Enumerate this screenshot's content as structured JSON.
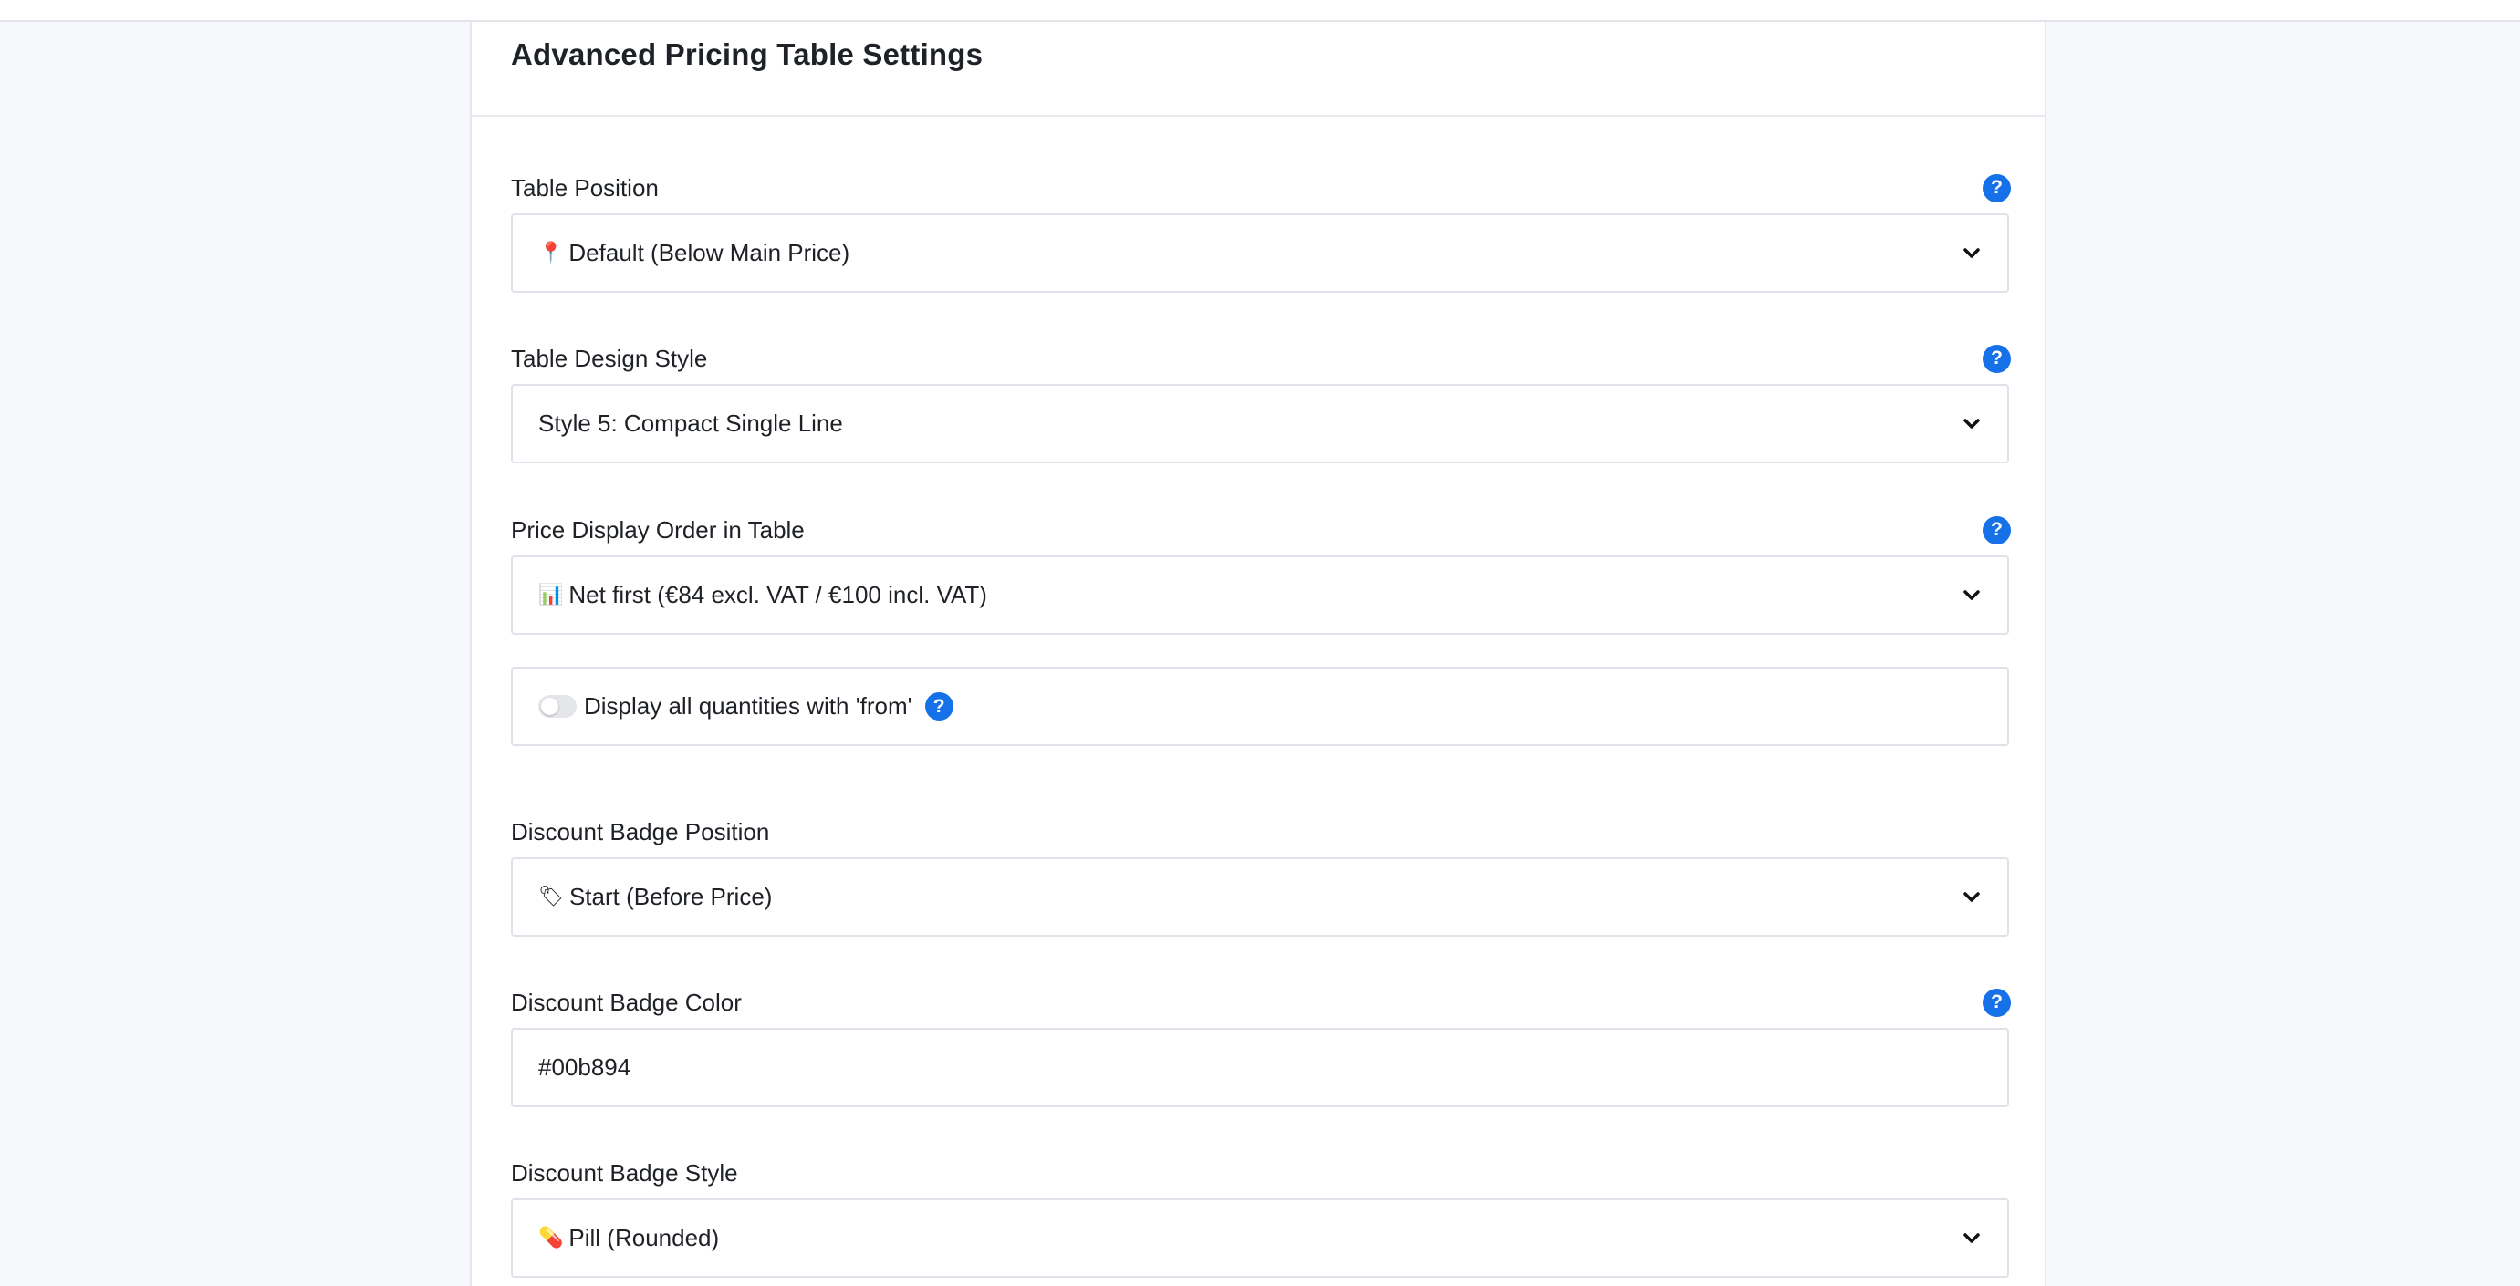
{
  "panel": {
    "title": "Advanced Pricing Table Settings"
  },
  "help_icon_glyph": "?",
  "fields": {
    "table_position": {
      "label": "Table Position",
      "emoji": "📍",
      "value": "Default (Below Main Price)",
      "icon": "pin-icon"
    },
    "table_design_style": {
      "label": "Table Design Style",
      "value": "Style 5: Compact Single Line"
    },
    "price_display_order": {
      "label": "Price Display Order in Table",
      "emoji": "📊",
      "value": "Net first (€84 excl. VAT / €100 incl. VAT)",
      "icon": "bar-chart-icon"
    },
    "display_from_toggle": {
      "label": "Display all quantities with 'from'",
      "enabled": false
    },
    "discount_badge_position": {
      "label": "Discount Badge Position",
      "emoji": "🏷",
      "value": "Start (Before Price)",
      "icon": "tag-icon"
    },
    "discount_badge_color": {
      "label": "Discount Badge Color",
      "value": "#00b894"
    },
    "discount_badge_style": {
      "label": "Discount Badge Style",
      "emoji": "💊",
      "value": "Pill (Rounded)",
      "icon": "pill-icon"
    }
  },
  "colors": {
    "accent": "#1671e8",
    "background": "#f7f8fc",
    "border": "#dfe2e8"
  }
}
